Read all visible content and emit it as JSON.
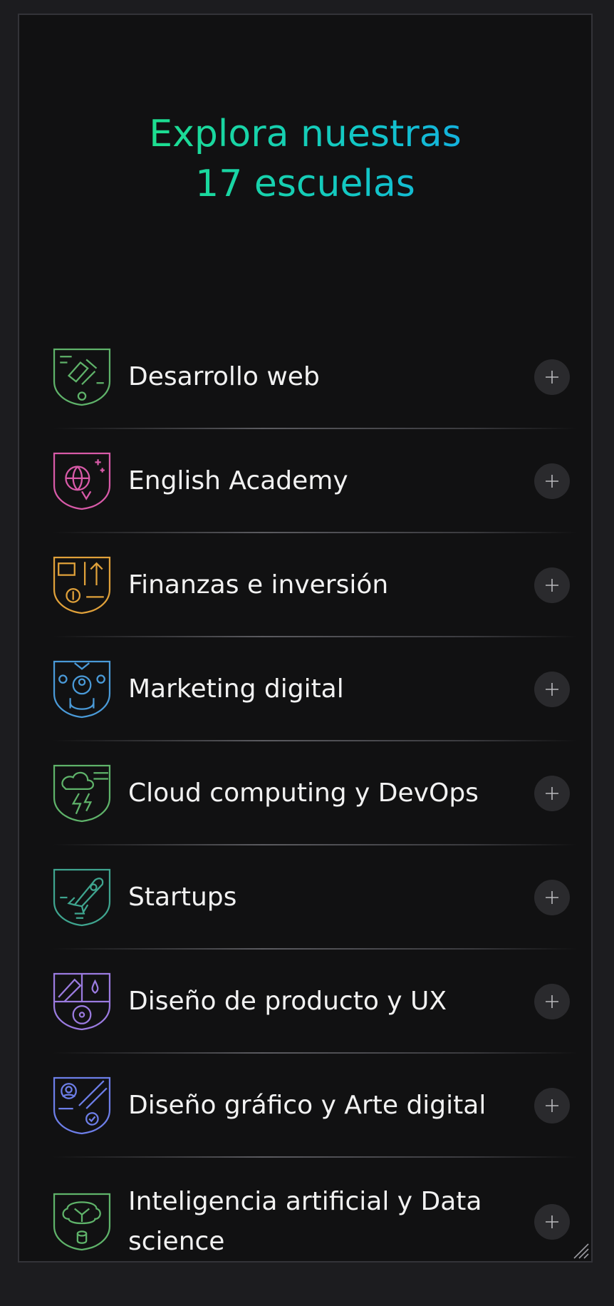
{
  "header": {
    "title": "Explora nuestras 17 escuelas"
  },
  "schools": [
    {
      "label": "Desarrollo web",
      "icon": "code-shield-icon",
      "color": "#5fb36a"
    },
    {
      "label": "English Academy",
      "icon": "globe-shield-icon",
      "color": "#d85aa8"
    },
    {
      "label": "Finanzas e inversión",
      "icon": "finance-shield-icon",
      "color": "#e0a13a"
    },
    {
      "label": "Marketing digital",
      "icon": "marketing-shield-icon",
      "color": "#4a9ad8"
    },
    {
      "label": "Cloud computing y DevOps",
      "icon": "cloud-shield-icon",
      "color": "#5fb36a"
    },
    {
      "label": "Startups",
      "icon": "rocket-shield-icon",
      "color": "#3fa58f"
    },
    {
      "label": "Diseño de producto y UX",
      "icon": "design-shield-icon",
      "color": "#9b7be0"
    },
    {
      "label": "Diseño gráfico y Arte digital",
      "icon": "art-shield-icon",
      "color": "#6d7ee8"
    },
    {
      "label": "Inteligencia artificial y Data science",
      "icon": "ai-shield-icon",
      "color": "#5fb36a"
    }
  ],
  "colors": {
    "background": "#111112",
    "title_gradient": [
      "#1ee08a",
      "#14a8e8"
    ],
    "text": "#f2f2f2",
    "plus_button": "#2a2a2d"
  }
}
